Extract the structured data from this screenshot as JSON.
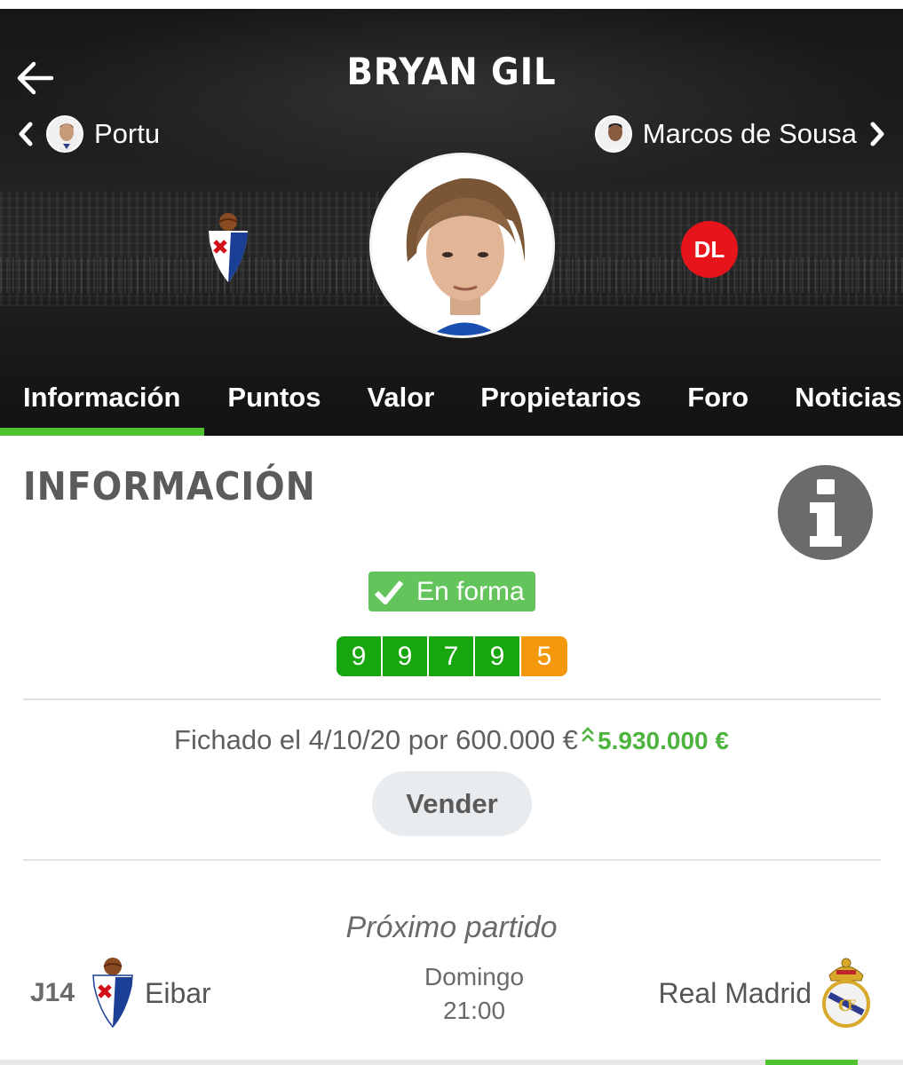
{
  "header": {
    "player_name": "BRYAN GIL",
    "prev_player": "Portu",
    "next_player": "Marcos de Sousa",
    "position": "DL",
    "team_crest_text": "S.D. EIBAR"
  },
  "tabs": [
    {
      "label": "Información",
      "active": true
    },
    {
      "label": "Puntos",
      "active": false
    },
    {
      "label": "Valor",
      "active": false
    },
    {
      "label": "Propietarios",
      "active": false
    },
    {
      "label": "Foro",
      "active": false
    },
    {
      "label": "Noticias",
      "active": false
    }
  ],
  "info": {
    "section_title": "INFORMACIÓN",
    "form_status": "En forma",
    "recent_scores": [
      {
        "value": "9",
        "color": "#17a60e"
      },
      {
        "value": "9",
        "color": "#17a60e"
      },
      {
        "value": "7",
        "color": "#17a60e"
      },
      {
        "value": "9",
        "color": "#17a60e"
      },
      {
        "value": "5",
        "color": "#f5980c"
      }
    ],
    "signed_text": "Fichado el 4/10/20 por 600.000 €",
    "value_up": "5.930.000 €",
    "sell_label": "Vender"
  },
  "next_match": {
    "title": "Próximo partido",
    "round": "J14",
    "home_team": "Eibar",
    "day": "Domingo",
    "time": "21:00",
    "away_team": "Real Madrid"
  },
  "colors": {
    "accent_green": "#4ec32f",
    "form_green": "#62c45a",
    "position_red": "#e8141b",
    "value_up_green": "#4fb340"
  },
  "icons": {
    "back": "arrow-left-icon",
    "prev": "chevron-left-icon",
    "next": "chevron-right-icon",
    "info": "info-icon",
    "check": "check-icon",
    "value_up": "double-chevron-up-icon"
  }
}
